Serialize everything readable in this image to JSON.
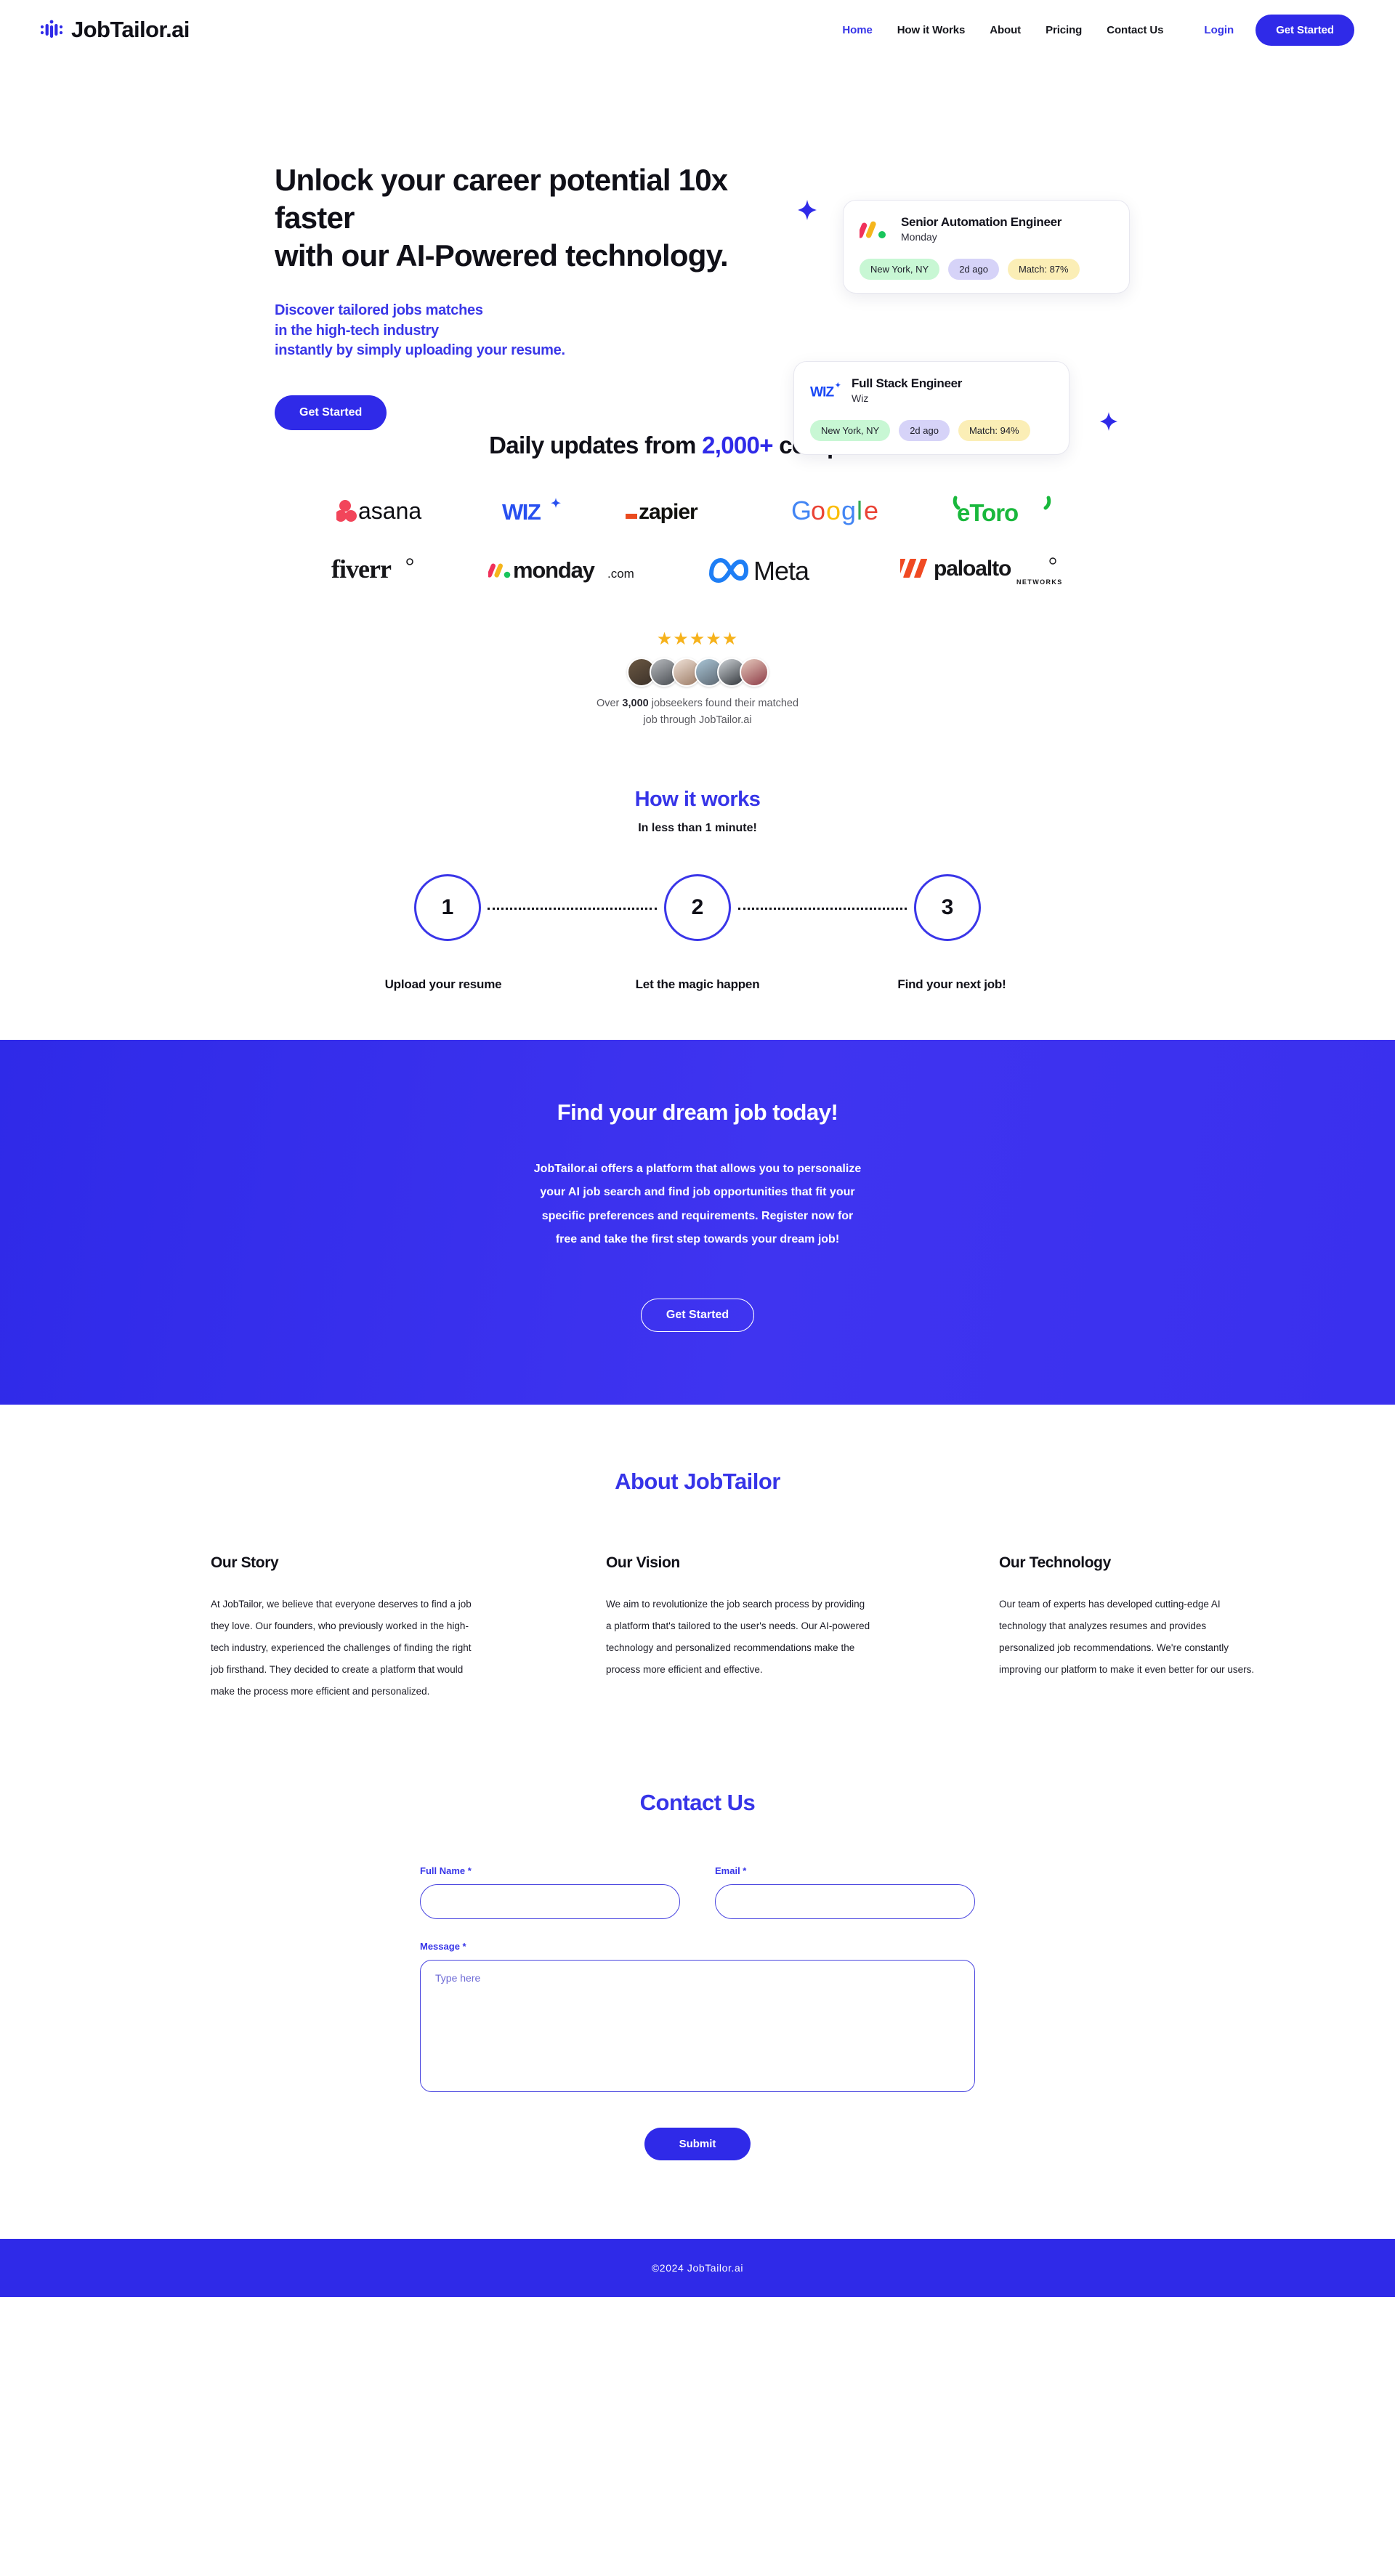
{
  "brand": {
    "name": "JobTailor.ai",
    "accent": "#2f2ae8",
    "logo_icon": "dotted-bars-logo"
  },
  "nav": {
    "links": [
      {
        "label": "Home",
        "active": true
      },
      {
        "label": "How it Works",
        "active": false
      },
      {
        "label": "About",
        "active": false
      },
      {
        "label": "Pricing",
        "active": false
      },
      {
        "label": "Contact Us",
        "active": false
      }
    ],
    "login_label": "Login",
    "cta_label": "Get Started"
  },
  "hero": {
    "title_line1": "Unlock your career potential 10x faster",
    "title_line2": "with our AI-Powered technology.",
    "sub_line1": "Discover tailored jobs matches",
    "sub_line2": "in the high-tech industry",
    "sub_line3": "instantly by simply uploading your resume.",
    "cta_label": "Get Started",
    "cards": [
      {
        "title": "Senior Automation Engineer",
        "company": "Monday",
        "logo_icon": "monday-logo",
        "location": "New York, NY",
        "age": "2d ago",
        "match": "Match: 87%"
      },
      {
        "title": "Full Stack Engineer",
        "company": "Wiz",
        "logo_icon": "wiz-logo",
        "location": "New York, NY",
        "age": "2d ago",
        "match": "Match: 94%"
      }
    ]
  },
  "companies": {
    "heading_before": "Daily updates from ",
    "heading_highlight": "2,000+",
    "heading_after": " companies.",
    "row1": [
      "asana",
      "wiz",
      "zapier",
      "Google",
      "eToro"
    ],
    "row2": [
      "fiverr",
      "monday.com",
      "Meta",
      "paloalto networks"
    ]
  },
  "social_proof": {
    "stars": "★★★★★",
    "star_count": 5,
    "avatar_count": 6,
    "text_before": "Over ",
    "text_bold": "3,000",
    "text_after": " jobseekers found their matched",
    "text_line2": "job through JobTailor.ai"
  },
  "how_it_works": {
    "title": "How it works",
    "subtitle": "In less than 1 minute!",
    "steps": [
      {
        "number": "1",
        "label": "Upload your resume"
      },
      {
        "number": "2",
        "label": "Let the magic happen"
      },
      {
        "number": "3",
        "label": "Find your next job!"
      }
    ]
  },
  "dream_band": {
    "title": "Find your dream job today!",
    "body_line1": "JobTailor.ai offers a platform that allows you to personalize",
    "body_line2": "your AI job search and find job opportunities that fit your",
    "body_line3": "specific preferences and requirements. Register now for",
    "body_line4": "free and take the first step towards your dream job!",
    "cta_label": "Get Started"
  },
  "about": {
    "title": "About JobTailor",
    "columns": [
      {
        "heading": "Our Story",
        "body": "At JobTailor, we believe that everyone deserves to find a job they love. Our founders, who previously worked in the high-tech industry, experienced the challenges of finding the right job firsthand. They decided to create a platform that would make the process more efficient and personalized."
      },
      {
        "heading": "Our Vision",
        "body": "We aim to revolutionize the job search process by providing a platform that's tailored to the user's needs. Our AI-powered technology and personalized recommendations make the process more efficient and effective."
      },
      {
        "heading": "Our Technology",
        "body": "Our team of experts has developed cutting-edge AI technology that analyzes resumes and provides personalized job recommendations. We're constantly improving our platform to make it even better for our users."
      }
    ]
  },
  "contact": {
    "title": "Contact Us",
    "full_name_label": "Full Name *",
    "full_name_value": "",
    "full_name_placeholder": "",
    "email_label": "Email *",
    "email_value": "",
    "email_placeholder": "",
    "message_label": "Message *",
    "message_value": "",
    "message_placeholder": "Type here",
    "submit_label": "Submit"
  },
  "footer": {
    "copyright": "©2024 JobTailor.ai"
  }
}
